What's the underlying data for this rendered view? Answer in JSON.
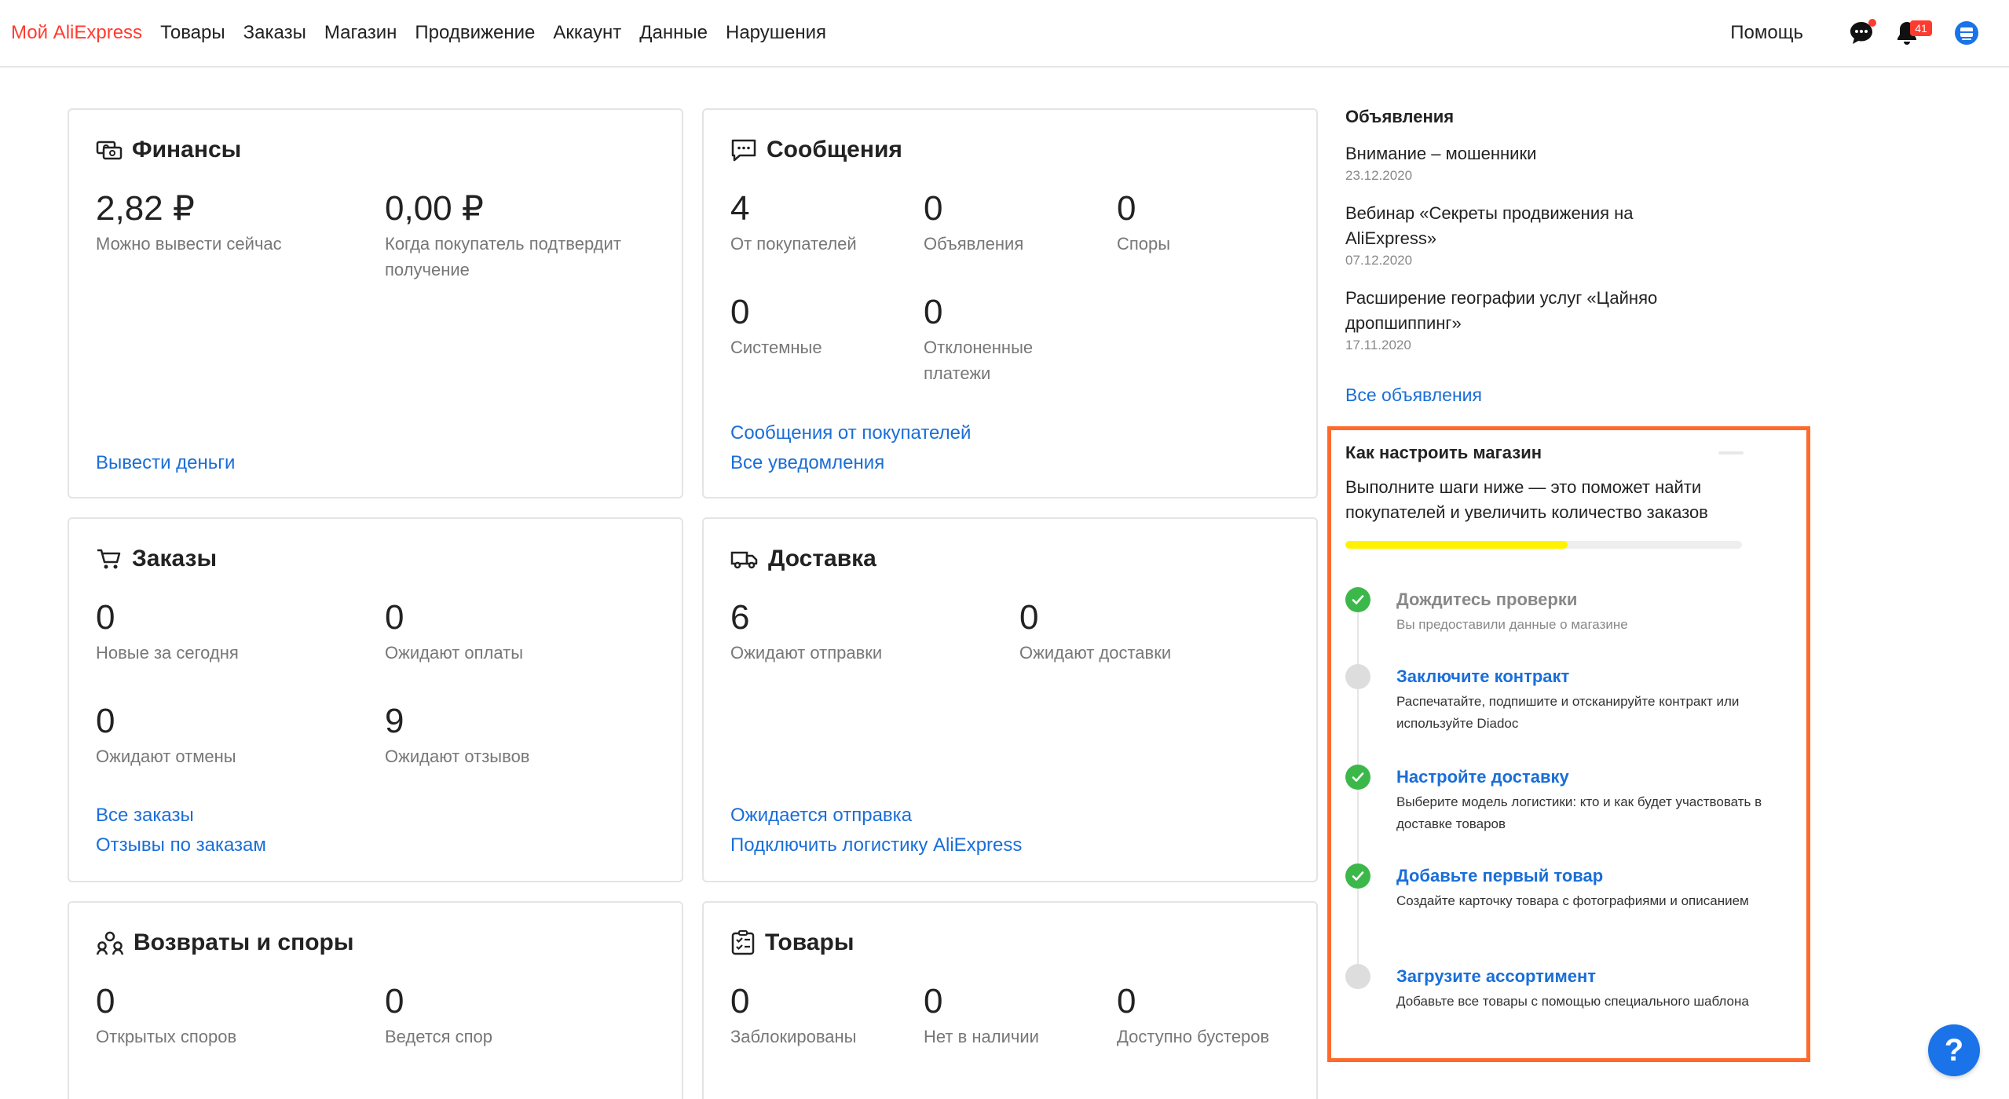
{
  "nav": {
    "brand": "Мой AliExpress",
    "items": [
      "Товары",
      "Заказы",
      "Магазин",
      "Продвижение",
      "Аккаунт",
      "Данные",
      "Нарушения"
    ],
    "help": "Помощь",
    "notifications_count": "41",
    "icons": [
      "chat-icon",
      "bell-icon",
      "profile-icon"
    ]
  },
  "finance": {
    "title": "Финансы",
    "stats": [
      {
        "value": "2,82 ₽",
        "label": "Можно вывести сейчас"
      },
      {
        "value": "0,00 ₽",
        "label": "Когда покупатель подтвердит получение"
      }
    ],
    "links": [
      "Вывести деньги"
    ]
  },
  "messages": {
    "title": "Сообщения",
    "stats": [
      {
        "value": "4",
        "label": "От покупателей"
      },
      {
        "value": "0",
        "label": "Объявления"
      },
      {
        "value": "0",
        "label": "Споры"
      },
      {
        "value": "0",
        "label": "Системные"
      },
      {
        "value": "0",
        "label": "Отклоненные платежи"
      }
    ],
    "links": [
      "Сообщения от покупателей",
      "Все уведомления"
    ]
  },
  "orders": {
    "title": "Заказы",
    "stats": [
      {
        "value": "0",
        "label": "Новые за сегодня"
      },
      {
        "value": "0",
        "label": "Ожидают оплаты"
      },
      {
        "value": "0",
        "label": "Ожидают отмены"
      },
      {
        "value": "9",
        "label": "Ожидают отзывов"
      }
    ],
    "links": [
      "Все заказы",
      "Отзывы по заказам"
    ]
  },
  "delivery": {
    "title": "Доставка",
    "stats": [
      {
        "value": "6",
        "label": "Ожидают отправки"
      },
      {
        "value": "0",
        "label": "Ожидают доставки"
      }
    ],
    "links": [
      "Ожидается отправка",
      "Подключить логистику AliExpress"
    ]
  },
  "returns": {
    "title": "Возвраты и споры",
    "stats": [
      {
        "value": "0",
        "label": "Открытых споров"
      },
      {
        "value": "0",
        "label": "Ведется спор"
      }
    ]
  },
  "products": {
    "title": "Товары",
    "stats": [
      {
        "value": "0",
        "label": "Заблокированы"
      },
      {
        "value": "0",
        "label": "Нет в наличии"
      },
      {
        "value": "0",
        "label": "Доступно бустеров"
      }
    ]
  },
  "announcements": {
    "header": "Объявления",
    "items": [
      {
        "title": "Внимание – мошенники",
        "date": "23.12.2020"
      },
      {
        "title": "Вебинар «Секреты продвижения на AliExpress»",
        "date": "07.12.2020"
      },
      {
        "title": "Расширение географии услуг «Цайняо дропшиппинг»",
        "date": "17.11.2020"
      }
    ],
    "all_link": "Все объявления"
  },
  "setup": {
    "title": "Как настроить магазин",
    "description": "Выполните шаги ниже — это поможет найти покупателей и увеличить количество заказов",
    "progress": 0.56,
    "colors": {
      "accent": "#ff6a2b",
      "progress": "#fff200",
      "done": "#3cb84a",
      "link": "#1a6ed8"
    },
    "steps": [
      {
        "title": "Дождитесь проверки",
        "desc": "Вы предоставили данные о магазине",
        "done": true
      },
      {
        "title": "Заключите контракт",
        "desc": "Распечатайте, подпишите и отсканируйте контракт или используйте Diadoc",
        "done": false
      },
      {
        "title": "Настройте доставку",
        "desc": "Выберите модель логистики: кто и как будет участвовать в доставке товаров",
        "done": true
      },
      {
        "title": "Добавьте первый товар",
        "desc": "Создайте карточку товара с фотографиями и описанием",
        "done": true
      },
      {
        "title": "Загрузите ассортимент",
        "desc": "Добавьте все товары с помощью специального шаблона",
        "done": false
      }
    ]
  },
  "help_bubble": "?"
}
